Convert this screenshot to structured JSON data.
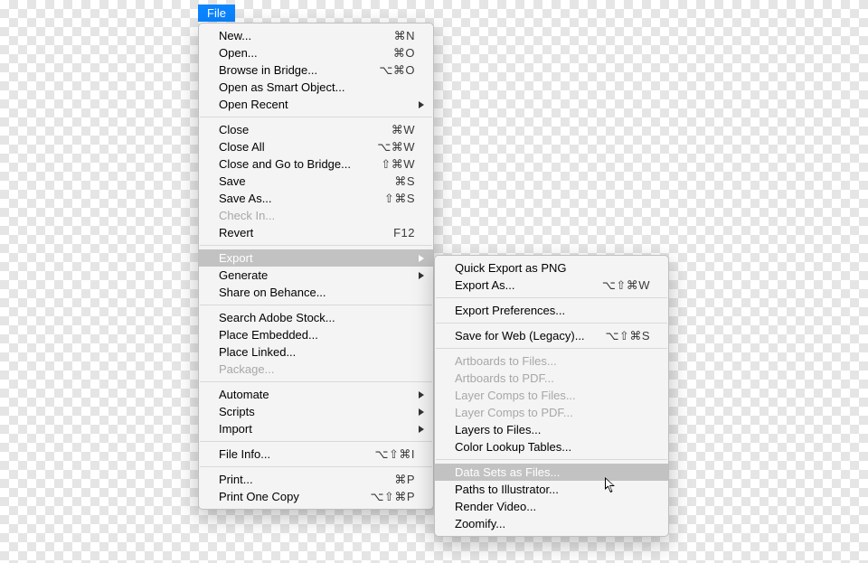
{
  "menu_button": "File",
  "file_menu": {
    "groups": [
      [
        {
          "id": "new",
          "label": "New...",
          "shortcut": "⌘N"
        },
        {
          "id": "open",
          "label": "Open...",
          "shortcut": "⌘O"
        },
        {
          "id": "browse-in-bridge",
          "label": "Browse in Bridge...",
          "shortcut": "⌥⌘O"
        },
        {
          "id": "open-as-smart-object",
          "label": "Open as Smart Object..."
        },
        {
          "id": "open-recent",
          "label": "Open Recent",
          "submenu": true
        }
      ],
      [
        {
          "id": "close",
          "label": "Close",
          "shortcut": "⌘W"
        },
        {
          "id": "close-all",
          "label": "Close All",
          "shortcut": "⌥⌘W"
        },
        {
          "id": "close-and-go-to-bridge",
          "label": "Close and Go to Bridge...",
          "shortcut": "⇧⌘W"
        },
        {
          "id": "save",
          "label": "Save",
          "shortcut": "⌘S"
        },
        {
          "id": "save-as",
          "label": "Save As...",
          "shortcut": "⇧⌘S"
        },
        {
          "id": "check-in",
          "label": "Check In...",
          "disabled": true
        },
        {
          "id": "revert",
          "label": "Revert",
          "shortcut": "F12"
        }
      ],
      [
        {
          "id": "export",
          "label": "Export",
          "submenu": true,
          "highlight": true
        },
        {
          "id": "generate",
          "label": "Generate",
          "submenu": true
        },
        {
          "id": "share-on-behance",
          "label": "Share on Behance..."
        }
      ],
      [
        {
          "id": "search-adobe-stock",
          "label": "Search Adobe Stock..."
        },
        {
          "id": "place-embedded",
          "label": "Place Embedded..."
        },
        {
          "id": "place-linked",
          "label": "Place Linked..."
        },
        {
          "id": "package",
          "label": "Package...",
          "disabled": true
        }
      ],
      [
        {
          "id": "automate",
          "label": "Automate",
          "submenu": true
        },
        {
          "id": "scripts",
          "label": "Scripts",
          "submenu": true
        },
        {
          "id": "import",
          "label": "Import",
          "submenu": true
        }
      ],
      [
        {
          "id": "file-info",
          "label": "File Info...",
          "shortcut": "⌥⇧⌘I"
        }
      ],
      [
        {
          "id": "print",
          "label": "Print...",
          "shortcut": "⌘P"
        },
        {
          "id": "print-one-copy",
          "label": "Print One Copy",
          "shortcut": "⌥⇧⌘P"
        }
      ]
    ]
  },
  "export_menu": {
    "groups": [
      [
        {
          "id": "quick-export-as-png",
          "label": "Quick Export as PNG"
        },
        {
          "id": "export-as",
          "label": "Export As...",
          "shortcut": "⌥⇧⌘W"
        }
      ],
      [
        {
          "id": "export-preferences",
          "label": "Export Preferences..."
        }
      ],
      [
        {
          "id": "save-for-web-legacy",
          "label": "Save for Web (Legacy)...",
          "shortcut": "⌥⇧⌘S"
        }
      ],
      [
        {
          "id": "artboards-to-files",
          "label": "Artboards to Files...",
          "disabled": true
        },
        {
          "id": "artboards-to-pdf",
          "label": "Artboards to PDF...",
          "disabled": true
        },
        {
          "id": "layer-comps-to-files",
          "label": "Layer Comps to Files...",
          "disabled": true
        },
        {
          "id": "layer-comps-to-pdf",
          "label": "Layer Comps to PDF...",
          "disabled": true
        },
        {
          "id": "layers-to-files",
          "label": "Layers to Files..."
        },
        {
          "id": "color-lookup-tables",
          "label": "Color Lookup Tables..."
        }
      ],
      [
        {
          "id": "data-sets-as-files",
          "label": "Data Sets as Files...",
          "highlight": true
        },
        {
          "id": "paths-to-illustrator",
          "label": "Paths to Illustrator..."
        },
        {
          "id": "render-video",
          "label": "Render Video..."
        },
        {
          "id": "zoomify",
          "label": "Zoomify..."
        }
      ]
    ]
  }
}
